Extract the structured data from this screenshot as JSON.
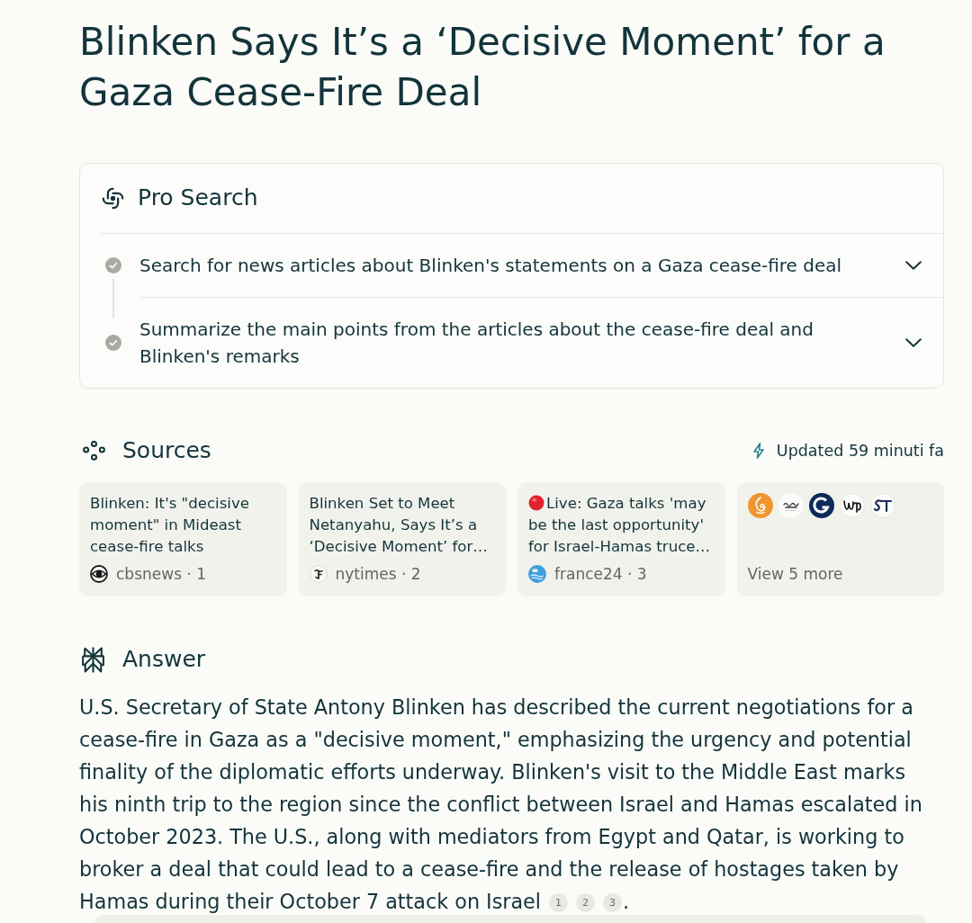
{
  "article": {
    "title": "Blinken Says It’s a ‘Decisive Moment’ for a Gaza Cease-Fire Deal"
  },
  "pro_search": {
    "title": "Pro Search",
    "steps": [
      {
        "text": "Search for news articles about Blinken's statements on a Gaza cease-fire deal",
        "completed": true,
        "expanded": false
      },
      {
        "text": "Summarize the main points from the articles about the cease-fire deal and Blinken's remarks",
        "completed": true,
        "expanded": false
      }
    ]
  },
  "sources": {
    "title": "Sources",
    "updated": "Updated 59 minuti fa",
    "cards": [
      {
        "kind": "article",
        "title": "Blinken: It's \"decisive moment\" in Mideast cease-fire talks",
        "source": "cbsnews · 1",
        "live": false
      },
      {
        "kind": "article",
        "title": "Blinken Set to Meet Netanyahu, Says It’s a ‘Decisive Moment’ for…",
        "source": "nytimes · 2",
        "live": false
      },
      {
        "kind": "article",
        "title": "Live: Gaza talks 'may be the last opportunity' for Israel-Hamas truce…",
        "source": "france24 · 3",
        "live": true
      },
      {
        "kind": "more",
        "label": "View 5 more"
      }
    ]
  },
  "answer": {
    "title": "Answer",
    "text": "U.S. Secretary of State Antony Blinken has described the current negotiations for a cease-fire in Gaza as a \"decisive moment,\" emphasizing the urgency and potential finality of the diplomatic efforts underway. Blinken's visit to the Middle East marks his ninth trip to the region since the conflict between Israel and Hamas escalated in October 2023. The U.S., along with mediators from Egypt and Qatar, is working to broker a deal that could lead to a cease-fire and the release of hostages taken by Hamas during their October 7 attack on Israel",
    "citations": [
      "1",
      "2",
      "3"
    ],
    "end": "."
  }
}
